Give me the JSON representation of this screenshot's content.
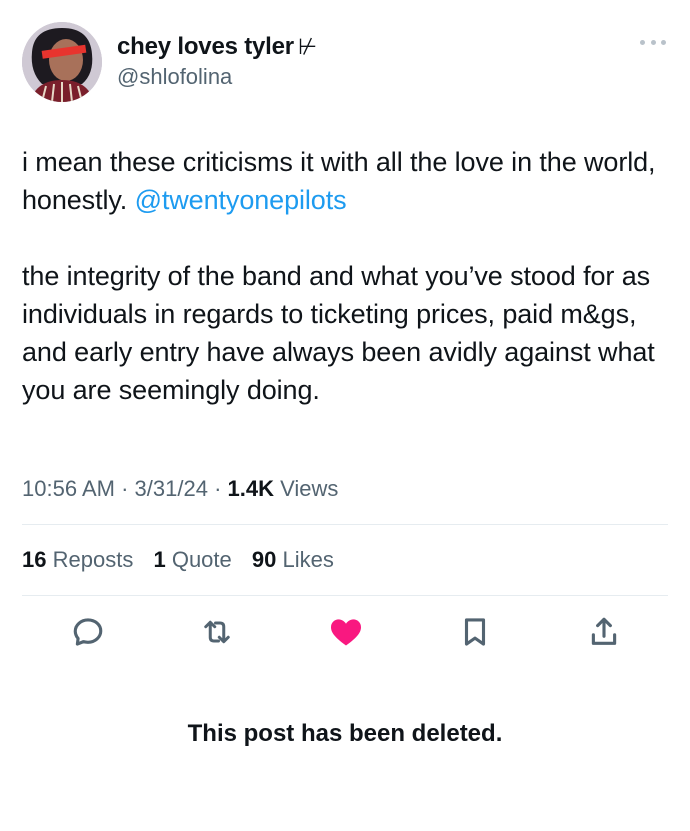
{
  "author": {
    "display_name": "chey loves tyler",
    "name_suffix": "⊬",
    "handle": "@shlofolina"
  },
  "post": {
    "line1_text": "i mean these criticisms it with all the love in the world, honestly. ",
    "mention": "@twentyonepilots",
    "paragraph2": "the integrity of the band and what you’ve stood for as individuals in regards to ticketing prices, paid m&gs, and early entry have always been avidly against what you are seemingly doing."
  },
  "meta": {
    "time": "10:56 AM",
    "separator": "·",
    "date": "3/31/24",
    "views_count": "1.4K",
    "views_label": "Views"
  },
  "stats": {
    "reposts_count": "16",
    "reposts_label": "Reposts",
    "quotes_count": "1",
    "quotes_label": "Quote",
    "likes_count": "90",
    "likes_label": "Likes"
  },
  "actions": {
    "reply_icon": "reply-icon",
    "repost_icon": "repost-icon",
    "like_icon": "heart-filled-icon",
    "bookmark_icon": "bookmark-icon",
    "share_icon": "share-icon",
    "like_color": "#f91880",
    "icon_color": "#536471"
  },
  "notice": {
    "deleted_text": "This post has been deleted."
  }
}
